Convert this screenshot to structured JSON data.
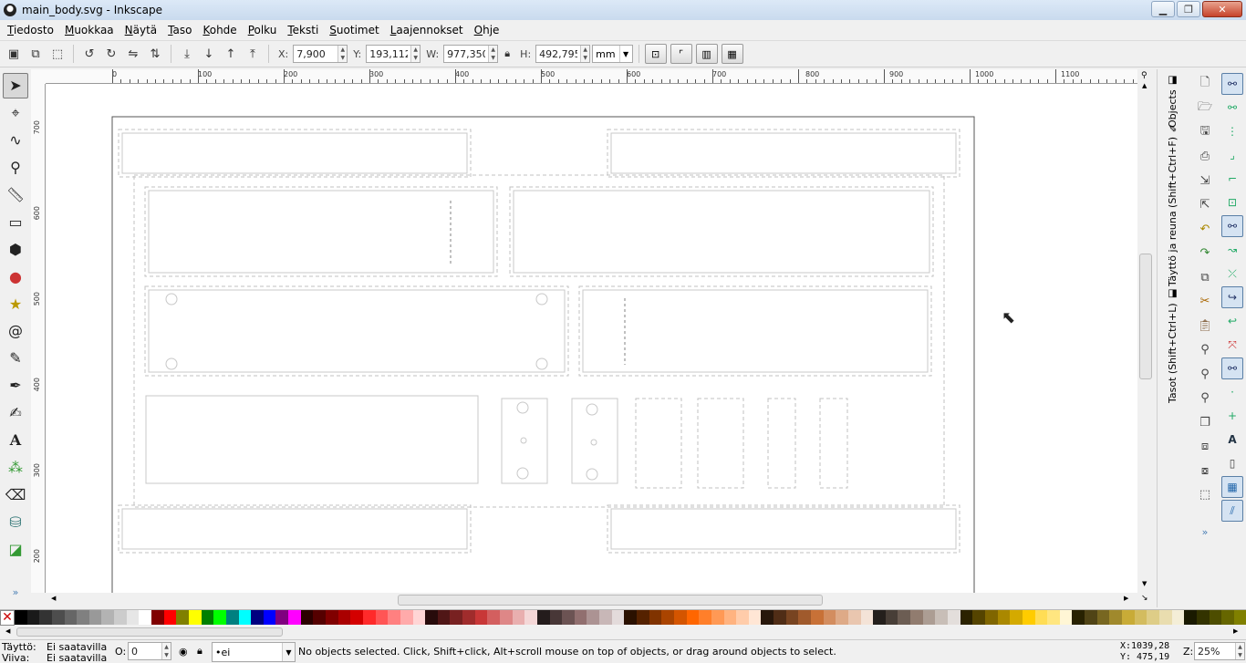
{
  "window": {
    "title": "main_body.svg - Inkscape",
    "minimize": "▁",
    "maximize": "❐",
    "close": "✕"
  },
  "menu": [
    {
      "label": "Tiedosto",
      "u": "T",
      "rest": "iedosto"
    },
    {
      "label": "Muokkaa",
      "u": "M",
      "rest": "uokkaa"
    },
    {
      "label": "Näytä",
      "u": "N",
      "rest": "äytä"
    },
    {
      "label": "Taso",
      "u": "T",
      "rest": "aso"
    },
    {
      "label": "Kohde",
      "u": "K",
      "rest": "ohde"
    },
    {
      "label": "Polku",
      "u": "P",
      "rest": "olku"
    },
    {
      "label": "Teksti",
      "u": "T",
      "rest": "eksti"
    },
    {
      "label": "Suotimet",
      "u": "S",
      "rest": "uotimet"
    },
    {
      "label": "Laajennokset",
      "u": "L",
      "rest": "aajennokset"
    },
    {
      "label": "Ohje",
      "u": "O",
      "rest": "hje"
    }
  ],
  "controls": {
    "x_label": "X:",
    "x_value": "7,900",
    "y_label": "Y:",
    "y_value": "193,112",
    "w_label": "W:",
    "w_value": "977,350",
    "h_label": "H:",
    "h_value": "492,795",
    "unit": "mm"
  },
  "ruler": {
    "h_labels": [
      "0",
      "100",
      "200",
      "300",
      "400",
      "500",
      "600",
      "700",
      "800",
      "900",
      "1000",
      "1100"
    ],
    "v_labels": [
      "700",
      "600",
      "500",
      "400",
      "300",
      "200"
    ]
  },
  "dock": {
    "tab_objects": "Objects",
    "tab_fill": "Täyttö ja reuna (Shift+Ctrl+F)",
    "tab_layers": "Tasot (Shift+Ctrl+L)"
  },
  "status": {
    "fill_label": "Täyttö:",
    "fill_value": "Ei saatavilla",
    "stroke_label": "Viiva:",
    "stroke_value": "Ei saatavilla",
    "opacity_label": "O:",
    "opacity_value": "0",
    "layer": "•ei",
    "message": "No objects selected. Click, Shift+click, Alt+scroll mouse on top of objects, or drag around objects to select.",
    "x_coord": "X:1039,28",
    "y_coord": "Y: 475,19",
    "zoom_label": "Z:",
    "zoom_value": "25%"
  },
  "colors": {
    "palette": [
      "#000000",
      "#1a1a1a",
      "#333333",
      "#4d4d4d",
      "#666666",
      "#808080",
      "#999999",
      "#b3b3b3",
      "#cccccc",
      "#e6e6e6",
      "#ffffff",
      "#800000",
      "#ff0000",
      "#808000",
      "#ffff00",
      "#008000",
      "#00ff00",
      "#008080",
      "#00ffff",
      "#000080",
      "#0000ff",
      "#800080",
      "#ff00ff",
      "#2b0000",
      "#550000",
      "#800000",
      "#aa0000",
      "#d40000",
      "#ff2a2a",
      "#ff5555",
      "#ff8080",
      "#ffaaaa",
      "#ffd5d5",
      "#280b0b",
      "#501616",
      "#782121",
      "#a02c2c",
      "#c83737",
      "#d35f5f",
      "#de8787",
      "#e9afaf",
      "#f4d7d7",
      "#241c1c",
      "#483737",
      "#6c5353",
      "#916f6f",
      "#ac9393",
      "#c8b7b7",
      "#e3dbdb",
      "#2b1100",
      "#552200",
      "#803300",
      "#aa4400",
      "#d45500",
      "#ff6600",
      "#ff7f2a",
      "#ff9955",
      "#ffb380",
      "#ffccaa",
      "#ffe6d5",
      "#28170b",
      "#502d16",
      "#784421",
      "#a05a2c",
      "#c87137",
      "#d38d5f",
      "#deaa87",
      "#e9c6af",
      "#f4e3d7",
      "#241f1c",
      "#483e37",
      "#6c5d53",
      "#917c6f",
      "#ac9d93",
      "#c8beb7",
      "#e3dedb",
      "#2b2200",
      "#554400",
      "#806600",
      "#aa8800",
      "#d4aa00",
      "#ffcc00",
      "#ffdd55",
      "#ffe680",
      "#fff6d5",
      "#282201",
      "#504416",
      "#786721",
      "#a0892c",
      "#c8ab37",
      "#d3bc5f",
      "#decd87",
      "#e9ddaf",
      "#f4eed7",
      "#1a1a00",
      "#333300",
      "#4d4d00",
      "#666600",
      "#808000"
    ],
    "canvas_stroke": "#c0c0c0"
  }
}
